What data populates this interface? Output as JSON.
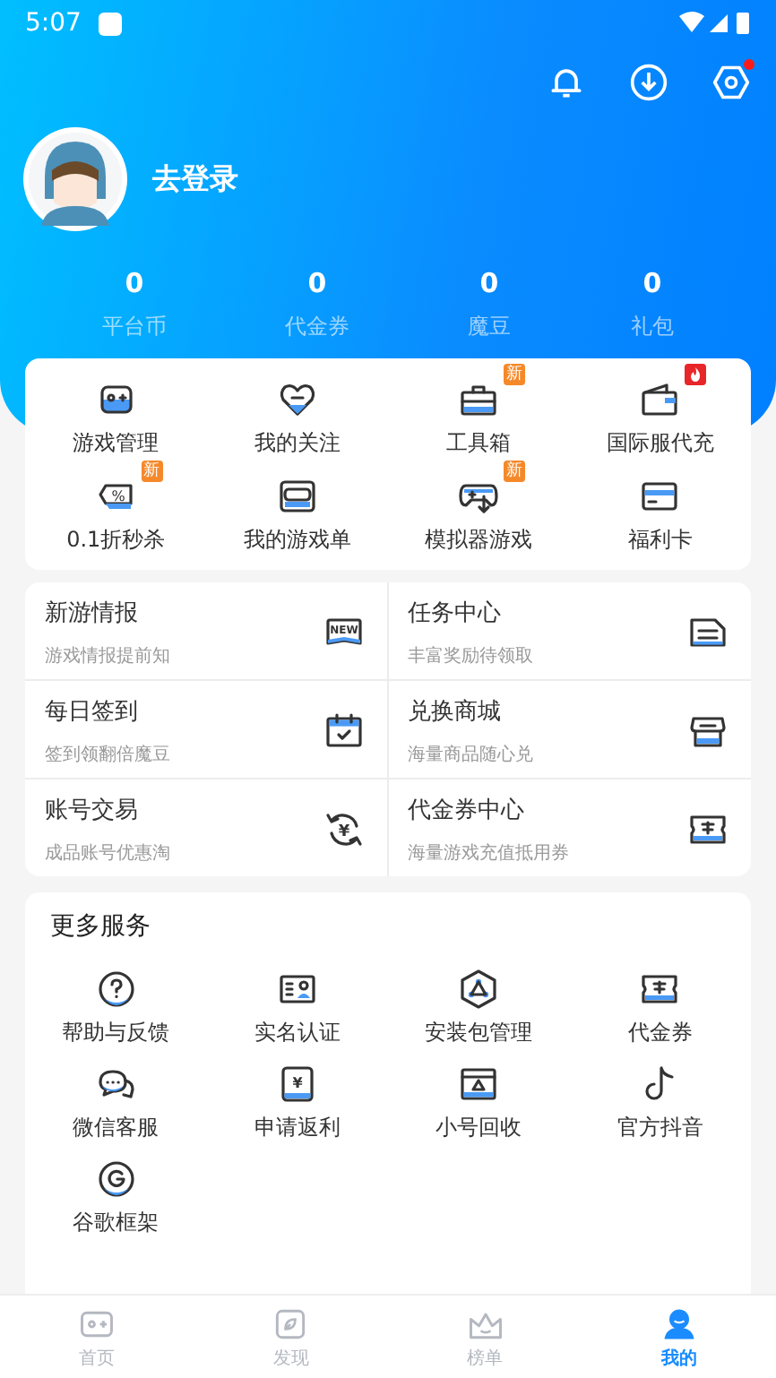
{
  "status_bar": {
    "time": "5:07"
  },
  "profile": {
    "login_label": "去登录",
    "notification_dot": true
  },
  "stats": [
    {
      "value": "0",
      "label": "平台币"
    },
    {
      "value": "0",
      "label": "代金券"
    },
    {
      "value": "0",
      "label": "魔豆"
    },
    {
      "value": "0",
      "label": "礼包"
    }
  ],
  "shortcuts": [
    {
      "label": "游戏管理"
    },
    {
      "label": "我的关注"
    },
    {
      "label": "工具箱",
      "badge": {
        "kind": "new",
        "text": "新"
      }
    },
    {
      "label": "国际服代充",
      "badge": {
        "kind": "hot"
      }
    },
    {
      "label": "0.1折秒杀",
      "icon_text": "%",
      "badge": {
        "kind": "new",
        "text": "新"
      }
    },
    {
      "label": "我的游戏单"
    },
    {
      "label": "模拟器游戏",
      "badge": {
        "kind": "new",
        "text": "新"
      }
    },
    {
      "label": "福利卡"
    }
  ],
  "features": [
    {
      "title": "新游情报",
      "subtitle": "游戏情报提前知",
      "icon_text": "NEW"
    },
    {
      "title": "任务中心",
      "subtitle": "丰富奖励待领取"
    },
    {
      "title": "每日签到",
      "subtitle": "签到领翻倍魔豆"
    },
    {
      "title": "兑换商城",
      "subtitle": "海量商品随心兑"
    },
    {
      "title": "账号交易",
      "subtitle": "成品账号优惠淘",
      "icon_text": "¥"
    },
    {
      "title": "代金券中心",
      "subtitle": "海量游戏充值抵用券"
    }
  ],
  "more_services": {
    "title": "更多服务",
    "items": [
      {
        "label": "帮助与反馈"
      },
      {
        "label": "实名认证"
      },
      {
        "label": "安装包管理"
      },
      {
        "label": "代金券"
      },
      {
        "label": "微信客服"
      },
      {
        "label": "申请返利",
        "icon_text": "¥"
      },
      {
        "label": "小号回收"
      },
      {
        "label": "官方抖音"
      },
      {
        "label": "谷歌框架"
      }
    ]
  },
  "bottom_nav": [
    {
      "label": "首页",
      "selected": false
    },
    {
      "label": "发现",
      "selected": false
    },
    {
      "label": "榜单",
      "selected": false
    },
    {
      "label": "我的",
      "selected": true
    }
  ]
}
